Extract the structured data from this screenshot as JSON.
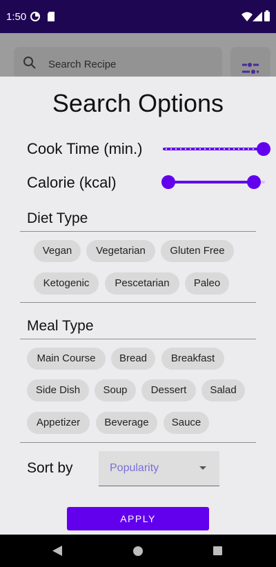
{
  "status_bar": {
    "time": "1:50"
  },
  "background": {
    "search_placeholder": "Search Recipe"
  },
  "sheet": {
    "title": "Search Options",
    "cook_time": {
      "label": "Cook Time (min.)",
      "value_fraction": 1.0
    },
    "calorie": {
      "label": "Calorie (kcal)",
      "range_start_fraction": 0.0,
      "range_end_fraction": 0.85
    },
    "diet_type": {
      "title": "Diet Type",
      "chips": [
        "Vegan",
        "Vegetarian",
        "Gluten Free",
        "Ketogenic",
        "Pescetarian",
        "Paleo"
      ]
    },
    "meal_type": {
      "title": "Meal Type",
      "chips": [
        "Main Course",
        "Bread",
        "Breakfast",
        "Side Dish",
        "Soup",
        "Dessert",
        "Salad",
        "Appetizer",
        "Beverage",
        "Sauce"
      ]
    },
    "sort": {
      "label": "Sort by",
      "selected": "Popularity"
    },
    "apply_label": "APPLY"
  },
  "colors": {
    "accent": "#6200ee",
    "status_bar": "#1e0652",
    "chip": "#d9d9d9",
    "dropdown_text": "#7a6fd6"
  }
}
